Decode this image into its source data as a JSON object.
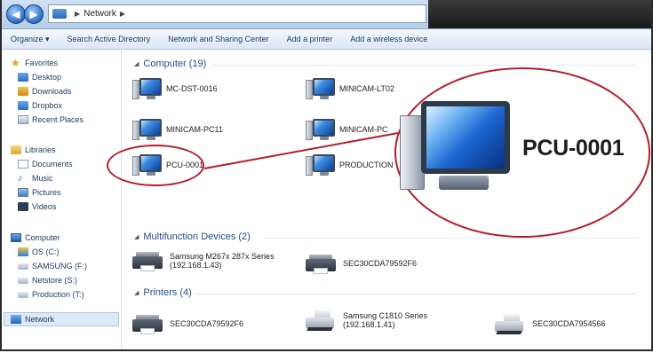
{
  "addressbar": {
    "path": [
      "Network"
    ]
  },
  "commandbar": {
    "items": [
      "Organize ▾",
      "Search Active Directory",
      "Network and Sharing Center",
      "Add a printer",
      "Add a wireless device"
    ]
  },
  "navpane": {
    "favorites": {
      "label": "Favorites",
      "items": [
        "Desktop",
        "Downloads",
        "Dropbox",
        "Recent Places"
      ]
    },
    "libraries": {
      "label": "Libraries",
      "items": [
        "Documents",
        "Music",
        "Pictures",
        "Videos"
      ]
    },
    "computer": {
      "label": "Computer",
      "items": [
        "OS (C:)",
        "SAMSUNG (F:)",
        "Netstore (S:)",
        "Production (T:)"
      ]
    },
    "network": {
      "label": "Network"
    }
  },
  "content": {
    "computer_group": {
      "label": "Computer (19)",
      "items": [
        "MC-DST-0016",
        "MINICAM-LT02",
        "MINICAM-PC11",
        "MINICAM-PC",
        "PCU-0001",
        "PRODUCTION"
      ]
    },
    "multifunction_group": {
      "label": "Multifunction Devices (2)",
      "items": [
        {
          "name": "Samsung M267x 287x Series",
          "sub": "(192.168.1.43)"
        },
        {
          "name": "SEC30CDA79592F6"
        }
      ]
    },
    "printers_group": {
      "label": "Printers (4)",
      "items": [
        {
          "name": "SEC30CDA79592F6"
        },
        {
          "name": "Samsung C1810 Series",
          "sub": "(192.168.1.41)"
        },
        {
          "name": "SEC30CDA7954566"
        }
      ]
    }
  },
  "callout": {
    "label": "PCU-0001",
    "color": "#b71b2b"
  }
}
